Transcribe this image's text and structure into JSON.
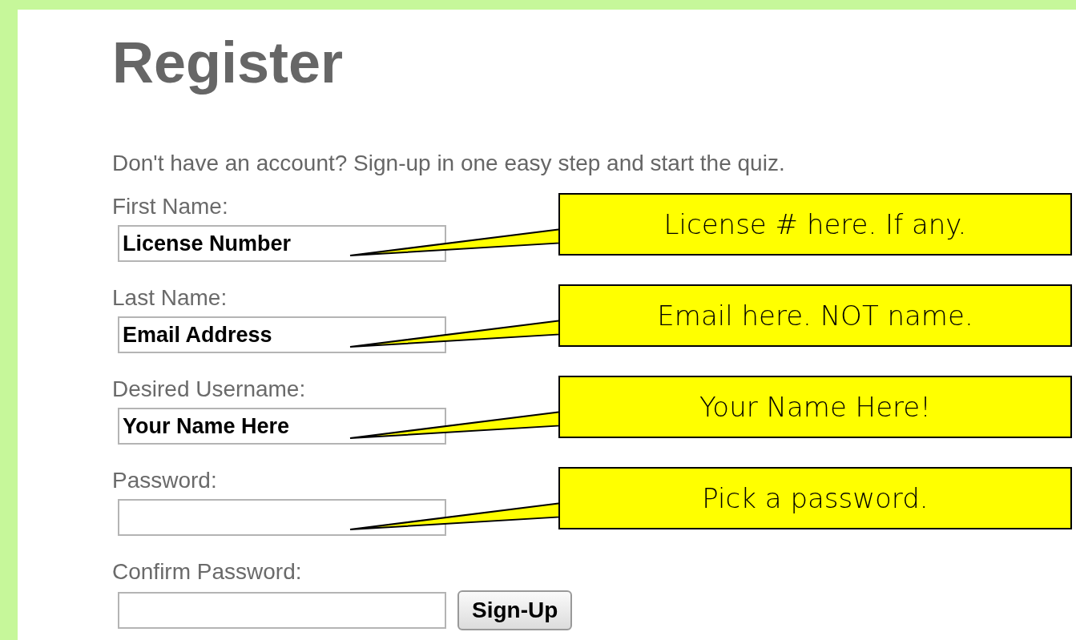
{
  "title": "Register",
  "intro": "Don't have an account? Sign-up in one easy step and start the quiz.",
  "fields": [
    {
      "label": "First Name:",
      "value": "License Number",
      "callout": "License # here. If any."
    },
    {
      "label": "Last Name:",
      "value": "Email Address",
      "callout": "Email here. NOT name."
    },
    {
      "label": "Desired Username:",
      "value": "Your Name Here",
      "callout": "Your Name Here!"
    },
    {
      "label": "Password:",
      "callout": "Pick a password."
    },
    {
      "label": "Confirm Password:"
    }
  ],
  "button": "Sign-Up"
}
